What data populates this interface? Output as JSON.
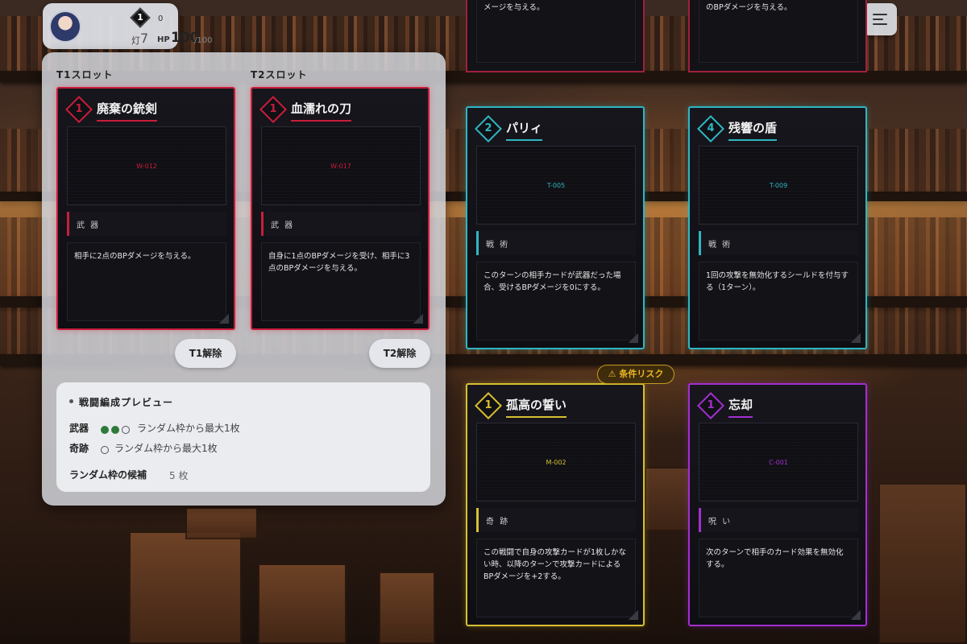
{
  "player": {
    "level": "1",
    "xp": "0",
    "lamp_label": "灯",
    "lamp_value": "7",
    "hp_label": "HP",
    "hp_value": "100",
    "hp_max": "/100",
    "avatar_icon": "avatar-icon"
  },
  "menu": {
    "icon": "hamburger-menu-icon"
  },
  "panel": {
    "t1_title": "T1スロット",
    "t2_title": "T2スロット",
    "t1_release": "T1解除",
    "t2_release": "T2解除",
    "preview": {
      "title": "戦闘編成プレビュー",
      "weapon_label": "武器",
      "weapon_text": "ランダム枠から最大1枚",
      "weapon_dots": [
        true,
        true,
        false
      ],
      "miracle_label": "奇跡",
      "miracle_text": "ランダム枠から最大1枚",
      "miracle_dots": [
        false
      ],
      "candidates_label": "ランダム枠の候補",
      "candidates_value": "5 枚"
    }
  },
  "slot_cards": [
    {
      "cost": "1",
      "name": "廃棄の銃剣",
      "code": "W-012",
      "type": "武 器",
      "desc": "相手に2点のBPダメージを与える。",
      "color": "#c81e3a"
    },
    {
      "cost": "1",
      "name": "血濡れの刀",
      "code": "W-017",
      "type": "武 器",
      "desc": "自身に1点のBPダメージを受け、相手に3点のBPダメージを与える。",
      "color": "#c81e3a"
    }
  ],
  "top_partial_cards": [
    {
      "desc": "メージを与える。",
      "color": "#a0203c"
    },
    {
      "desc": "のBPダメージを与える。",
      "color": "#a0203c"
    }
  ],
  "hand_cards": [
    {
      "cost": "2",
      "name": "パリィ",
      "code": "T-005",
      "type": "戦 術",
      "desc": "このターンの相手カードが武器だった場合、受けるBPダメージを0にする。",
      "color": "#2fb6c2"
    },
    {
      "cost": "4",
      "name": "残響の盾",
      "code": "T-009",
      "type": "戦 術",
      "desc": "1回の攻撃を無効化するシールドを付与する（1ターン）。",
      "color": "#2fb6c2"
    },
    {
      "cost": "1",
      "name": "孤高の誓い",
      "code": "M-002",
      "type": "奇 跡",
      "desc": "この戦闘で自身の攻撃カードが1枚しかない時、以降のターンで攻撃カードによるBPダメージを+2する。",
      "color": "#d8c030"
    },
    {
      "cost": "1",
      "name": "忘却",
      "code": "C-001",
      "type": "呪 い",
      "desc": "次のターンで相手のカード効果を無効化する。",
      "color": "#a32fd0"
    }
  ],
  "risk_badge": {
    "icon": "warning-icon",
    "label": "⚠ 条件リスク"
  }
}
